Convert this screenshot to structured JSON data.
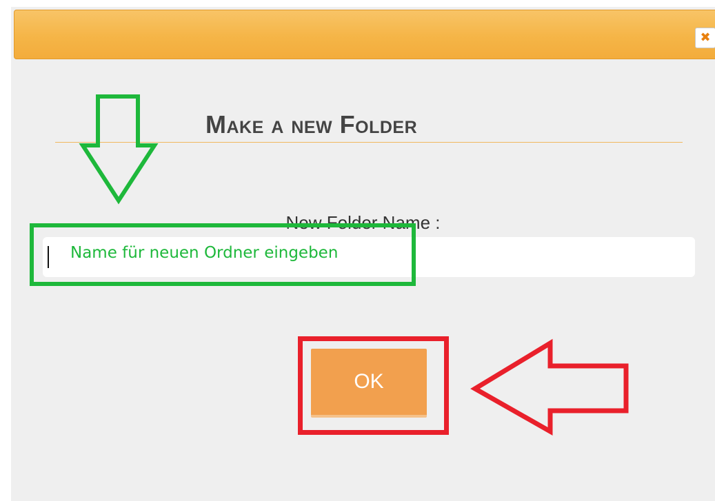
{
  "dialog": {
    "close_icon_glyph": "✖",
    "title": "Make a new Folder",
    "field_label": "New Folder Name :",
    "input_value": "",
    "ok_label": "OK"
  },
  "annotations": {
    "input_hint": "Name für neuen Ordner eingeben",
    "arrow_down_icon": "arrow-down-icon",
    "arrow_left_icon": "arrow-left-icon"
  },
  "colors": {
    "titlebar": "#f5b547",
    "ok_button": "#f2a04e",
    "green_annotation": "#1eb83b",
    "red_annotation": "#e9202b",
    "background": "#efefef"
  }
}
